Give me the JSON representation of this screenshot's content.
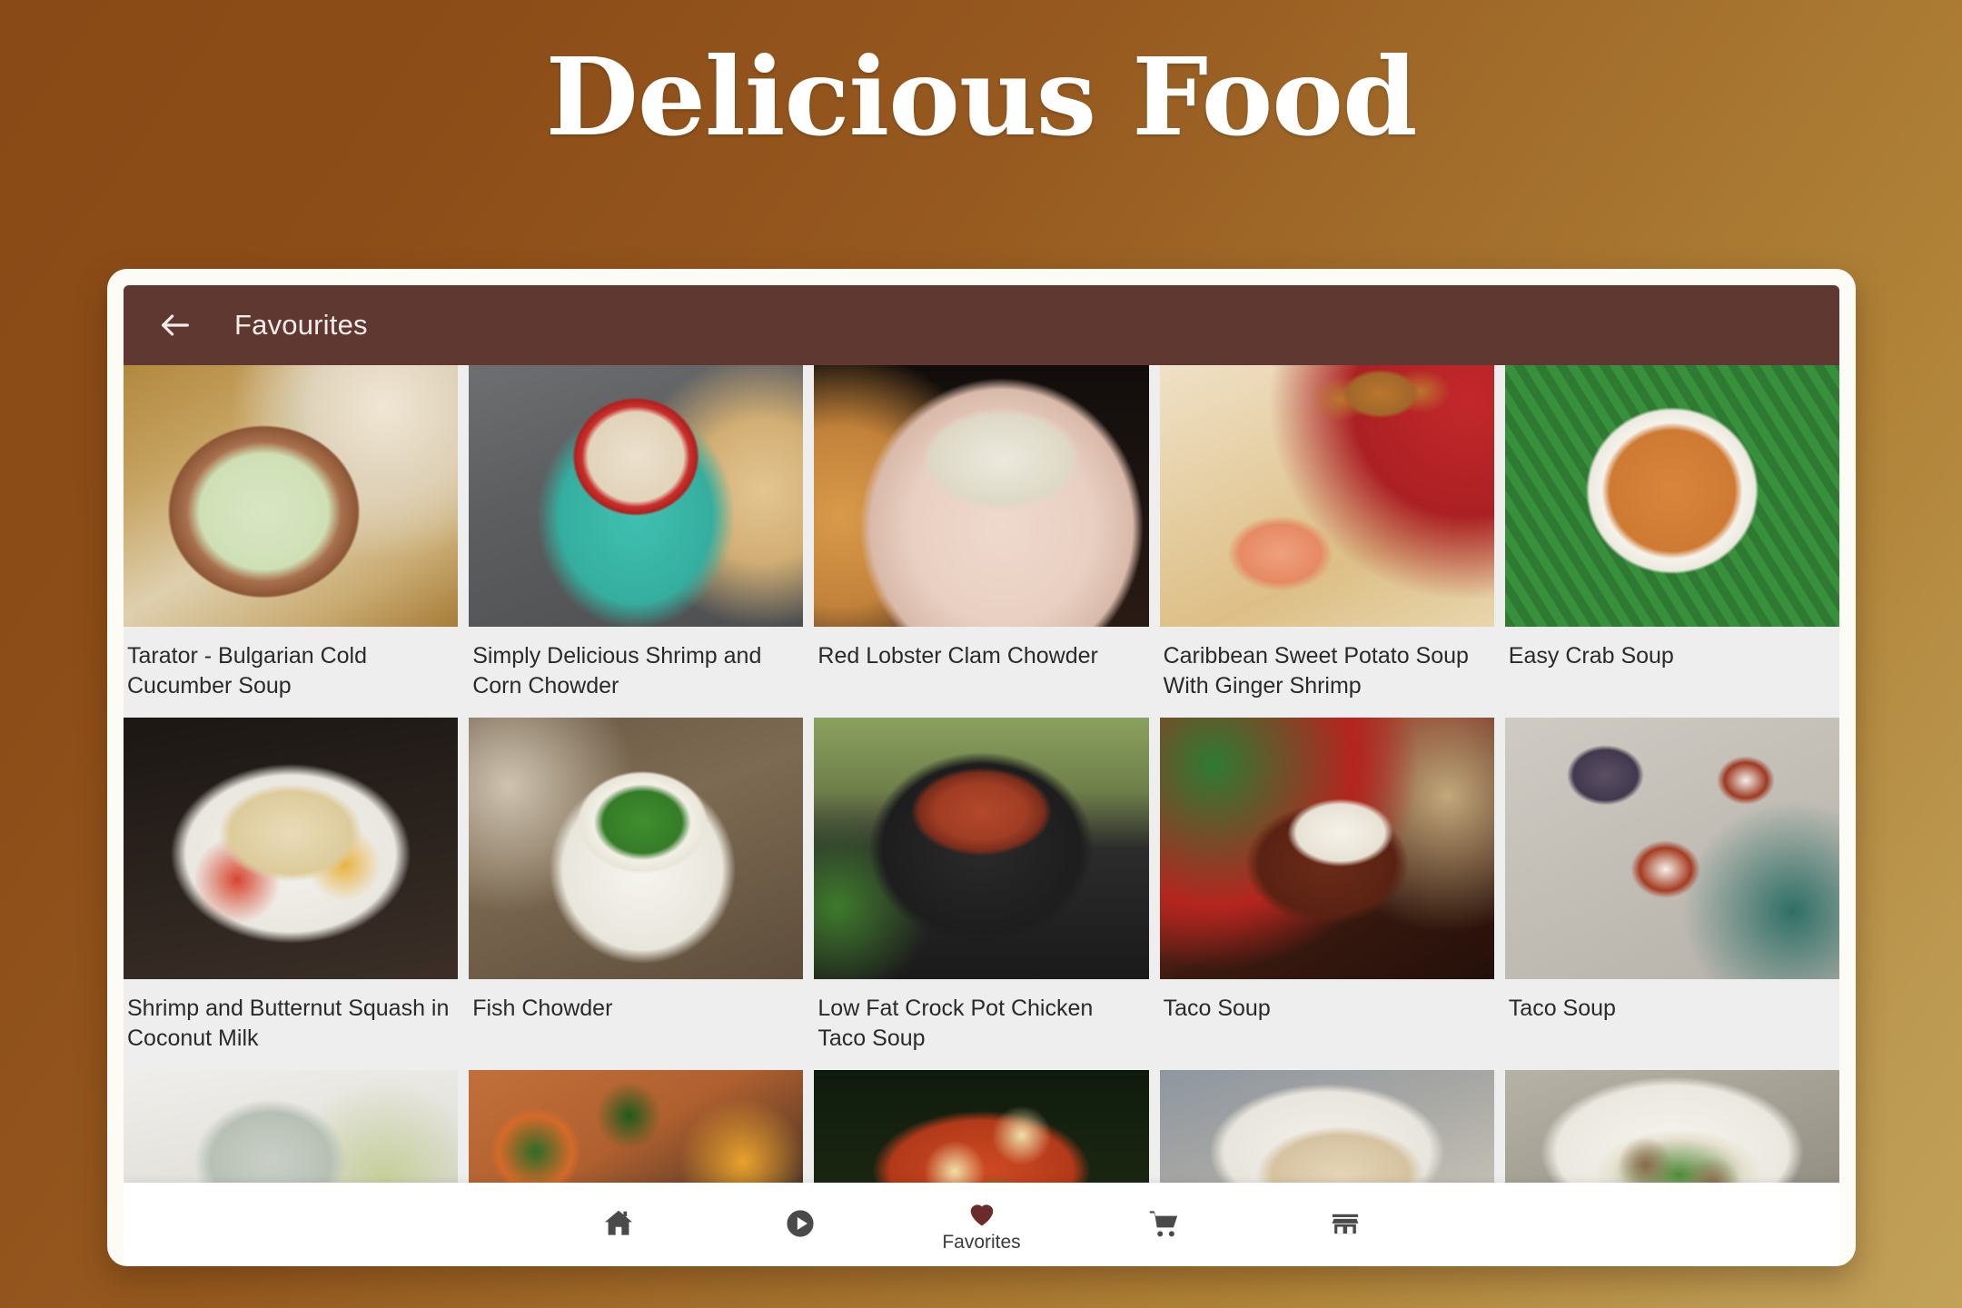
{
  "page": {
    "title": "Delicious Food",
    "background_start": "#8a4a17",
    "background_end": "#c2a159"
  },
  "app": {
    "toolbar": {
      "back_icon": "arrow-left-icon",
      "title": "Favourites",
      "background": "#603832",
      "text_color": "#f3ece9"
    },
    "grid": {
      "columns": 5,
      "items": [
        {
          "title": "Tarator - Bulgarian Cold Cucumber Soup",
          "image": "img-tarator"
        },
        {
          "title": "Simply Delicious Shrimp and Corn Chowder",
          "image": "img-shrimpcorn"
        },
        {
          "title": "Red Lobster Clam Chowder",
          "image": "img-redlobster"
        },
        {
          "title": "Caribbean Sweet Potato Soup With Ginger Shrimp",
          "image": "img-caribbean"
        },
        {
          "title": "Easy Crab Soup",
          "image": "img-easycrab"
        },
        {
          "title": "Shrimp and Butternut Squash in Coconut Milk",
          "image": "img-butternut"
        },
        {
          "title": "Fish Chowder",
          "image": "img-fishchowder"
        },
        {
          "title": "Low Fat Crock Pot Chicken Taco Soup",
          "image": "img-crockpot"
        },
        {
          "title": "Taco Soup",
          "image": "img-tacosoup1"
        },
        {
          "title": "Taco Soup",
          "image": "img-tacosoup2"
        },
        {
          "title": "",
          "image": "img-bottles"
        },
        {
          "title": "",
          "image": "img-kale"
        },
        {
          "title": "",
          "image": "img-gnocchi"
        },
        {
          "title": "",
          "image": "img-brothsoup"
        },
        {
          "title": "",
          "image": "img-meatball"
        }
      ]
    },
    "bottom_nav": {
      "active_color": "#6b2b2b",
      "inactive_color": "#4a4a4a",
      "items": [
        {
          "icon": "home-icon",
          "label": "",
          "active": false
        },
        {
          "icon": "play-circle-icon",
          "label": "",
          "active": false
        },
        {
          "icon": "heart-icon",
          "label": "Favorites",
          "active": true
        },
        {
          "icon": "shopping-cart-icon",
          "label": "",
          "active": false
        },
        {
          "icon": "store-icon",
          "label": "",
          "active": false
        }
      ]
    }
  }
}
